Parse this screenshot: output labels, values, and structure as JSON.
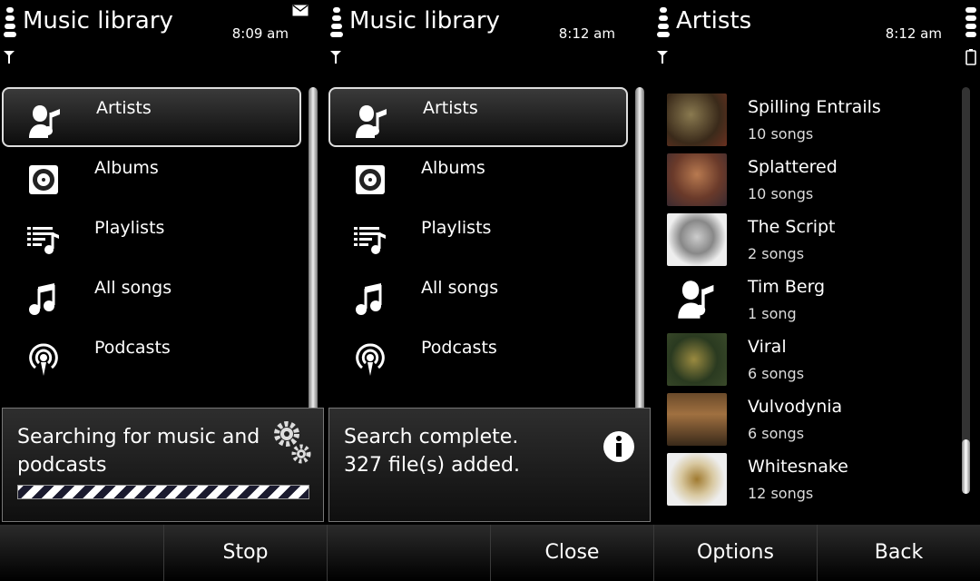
{
  "panels": [
    {
      "title": "Music library",
      "time": "8:09 am",
      "has_mail": true,
      "menu": [
        {
          "label": "Artists",
          "icon": "artist-icon",
          "selected": true
        },
        {
          "label": "Albums",
          "icon": "album-icon"
        },
        {
          "label": "Playlists",
          "icon": "playlist-icon"
        },
        {
          "label": "All songs",
          "icon": "music-note-icon"
        },
        {
          "label": "Podcasts",
          "icon": "podcast-icon"
        }
      ],
      "note": {
        "text": "Searching for music and podcasts",
        "icon": "gears-icon"
      }
    },
    {
      "title": "Music library",
      "time": "8:12 am",
      "menu": [
        {
          "label": "Artists",
          "icon": "artist-icon",
          "selected": true
        },
        {
          "label": "Albums",
          "icon": "album-icon"
        },
        {
          "label": "Playlists",
          "icon": "playlist-icon"
        },
        {
          "label": "All songs",
          "icon": "music-note-icon"
        },
        {
          "label": "Podcasts",
          "icon": "podcast-icon"
        }
      ],
      "note": {
        "line1": "Search complete.",
        "line2": "327 file(s) added.",
        "icon": "info-icon"
      }
    },
    {
      "title": "Artists",
      "time": "8:12 am",
      "artists": [
        {
          "name": "Spilling Entrails",
          "songs": "10 songs",
          "art": "album-art-icon"
        },
        {
          "name": "Splattered",
          "songs": "10 songs",
          "art": "album-art-icon"
        },
        {
          "name": "The Script",
          "songs": "2 songs",
          "art": "album-art-icon"
        },
        {
          "name": "Tim Berg",
          "songs": "1 song",
          "art": "artist-placeholder-icon"
        },
        {
          "name": "Viral",
          "songs": "6 songs",
          "art": "album-art-icon"
        },
        {
          "name": "Vulvodynia",
          "songs": "6 songs",
          "art": "album-art-icon"
        },
        {
          "name": "Whitesnake",
          "songs": "12 songs",
          "art": "album-art-icon"
        }
      ]
    }
  ],
  "softkeys": [
    "",
    "Stop",
    "",
    "Close",
    "Options",
    "Back"
  ],
  "colors": {
    "background": "#000000",
    "selection_border": "#dddddd",
    "text": "#ffffff"
  }
}
